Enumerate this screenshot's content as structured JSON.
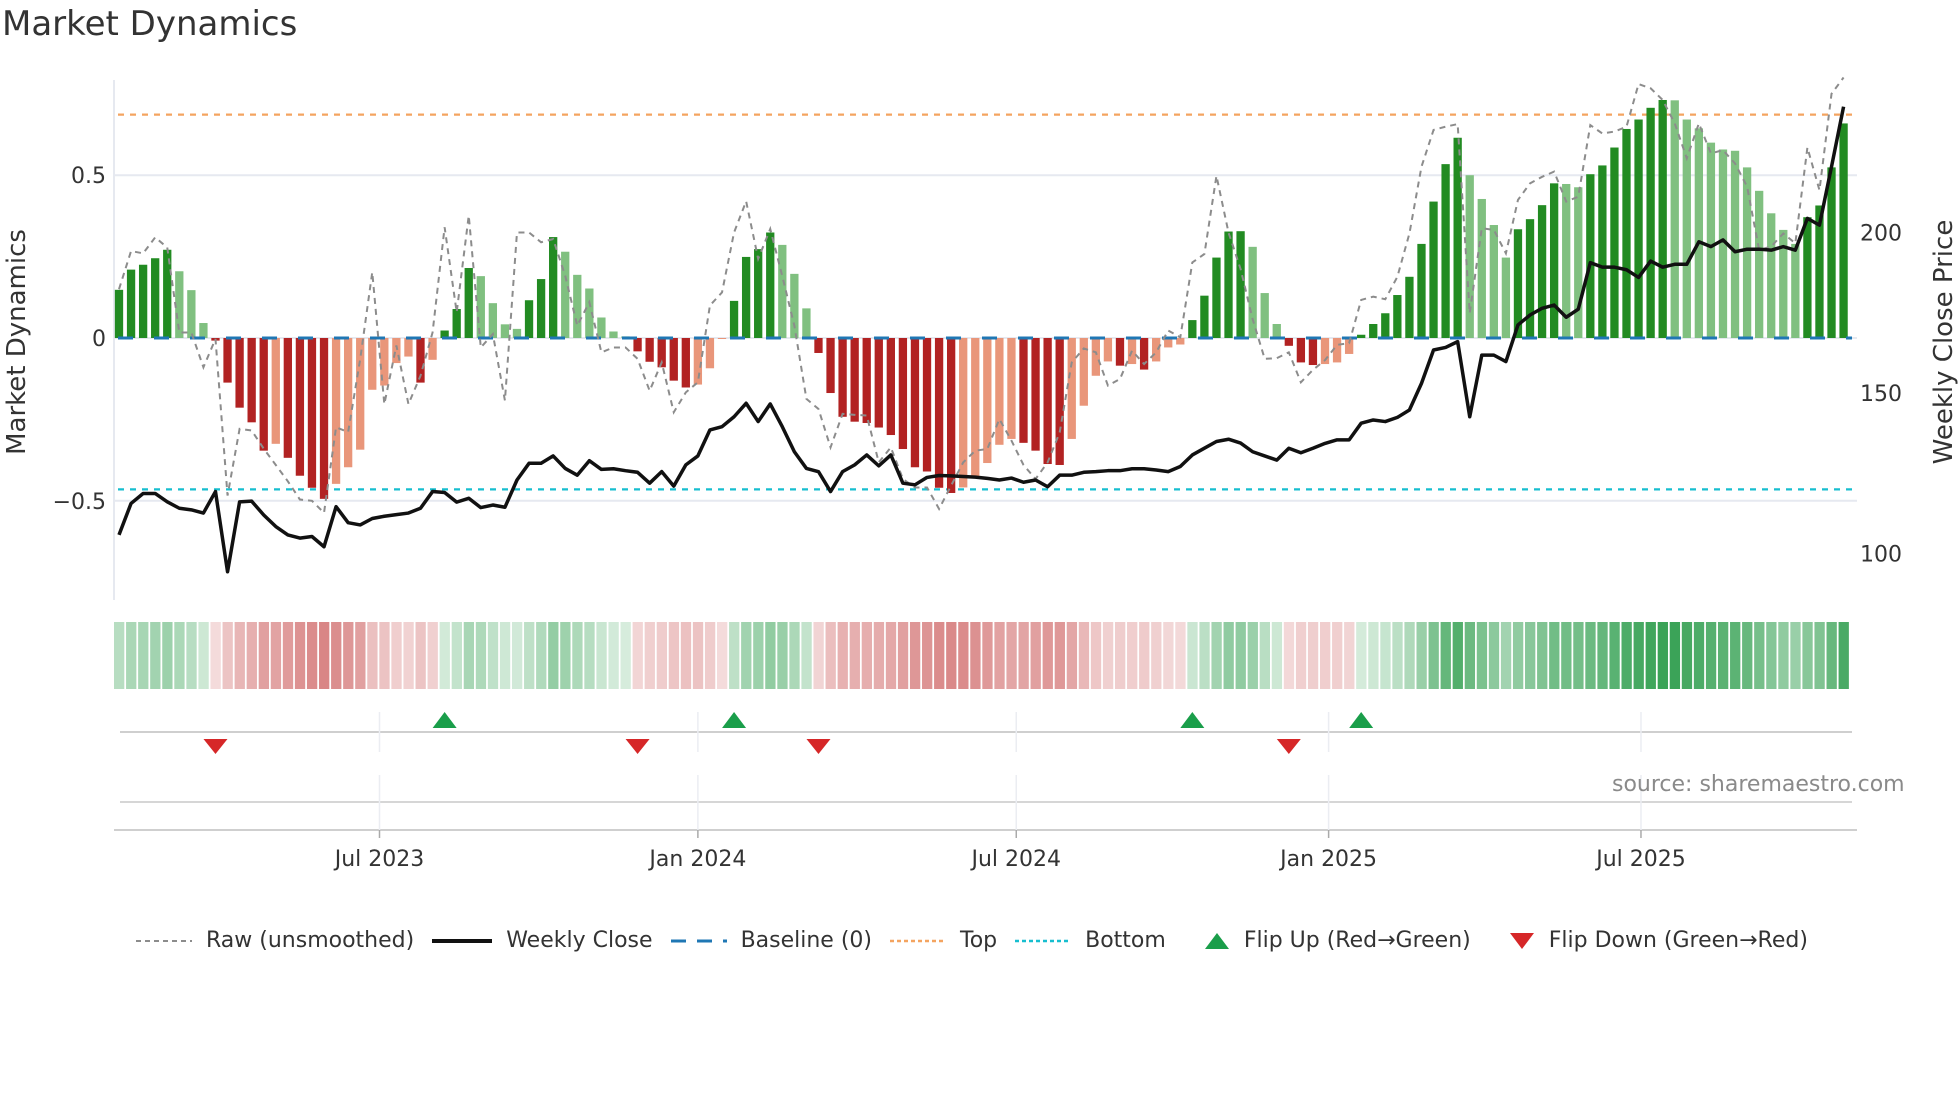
{
  "title": "Market Dynamics",
  "source": "source: sharemaestro.com",
  "legend": {
    "raw": "Raw (unsmoothed)",
    "close": "Weekly Close",
    "baseline": "Baseline (0)",
    "top": "Top",
    "bottom": "Bottom",
    "flip_up": "Flip Up (Red→Green)",
    "flip_down": "Flip Down (Green→Red)"
  },
  "colors": {
    "pos_strong": "#228b22",
    "pos_weak": "#80c080",
    "neg_strong": "#b22222",
    "neg_weak": "#e9967a",
    "raw": "#8c8c8c",
    "close": "#111111",
    "baseline": "#1f77b4",
    "top": "#f4a460",
    "bottom": "#17becf",
    "flip_up": "#1a9e4a",
    "flip_down": "#d62728"
  },
  "chart_data": {
    "type": "bar",
    "title": "Market Dynamics",
    "ylabel": "Market Dynamics",
    "y2label": "Weekly Close Price",
    "ylim": [
      -0.64,
      0.83
    ],
    "y2lim": [
      82,
      245
    ],
    "yticks": [
      {
        "v": 0.5,
        "label": "0.5"
      },
      {
        "v": 0,
        "label": "0"
      },
      {
        "v": -0.5,
        "label": "−0.5"
      }
    ],
    "y2ticks": [
      {
        "v": 200,
        "label": "200"
      },
      {
        "v": 150,
        "label": "150"
      },
      {
        "v": 100,
        "label": "100"
      }
    ],
    "xticks": [
      {
        "pos": 21.6,
        "label": "Jul 2023"
      },
      {
        "pos": 48.0,
        "label": "Jan 2024"
      },
      {
        "pos": 74.4,
        "label": "Jul 2024"
      },
      {
        "pos": 100.3,
        "label": "Jan 2025"
      },
      {
        "pos": 126.2,
        "label": "Jul 2025"
      }
    ],
    "top_level": 0.686,
    "bottom_level": -0.465,
    "baseline": 0,
    "legend_position": "bottom",
    "values": [
      0.148,
      0.21,
      0.225,
      0.245,
      0.271,
      0.205,
      0.147,
      0.046,
      -0.008,
      -0.137,
      -0.214,
      -0.259,
      -0.346,
      -0.325,
      -0.368,
      -0.423,
      -0.46,
      -0.494,
      -0.448,
      -0.397,
      -0.343,
      -0.159,
      -0.146,
      -0.077,
      -0.057,
      -0.137,
      -0.067,
      0.023,
      0.089,
      0.215,
      0.19,
      0.107,
      0.042,
      0.028,
      0.116,
      0.181,
      0.31,
      0.265,
      0.194,
      0.152,
      0.063,
      0.02,
      0.005,
      -0.041,
      -0.073,
      -0.09,
      -0.131,
      -0.152,
      -0.143,
      -0.093,
      -0.003,
      0.114,
      0.249,
      0.273,
      0.324,
      0.286,
      0.197,
      0.091,
      -0.046,
      -0.169,
      -0.242,
      -0.257,
      -0.261,
      -0.275,
      -0.298,
      -0.341,
      -0.397,
      -0.41,
      -0.46,
      -0.476,
      -0.459,
      -0.428,
      -0.384,
      -0.328,
      -0.31,
      -0.322,
      -0.346,
      -0.387,
      -0.39,
      -0.31,
      -0.208,
      -0.116,
      -0.072,
      -0.085,
      -0.08,
      -0.097,
      -0.072,
      -0.029,
      -0.02,
      0.055,
      0.13,
      0.247,
      0.327,
      0.328,
      0.28,
      0.138,
      0.043,
      -0.024,
      -0.075,
      -0.083,
      -0.08,
      -0.075,
      -0.049,
      0.01,
      0.043,
      0.076,
      0.132,
      0.188,
      0.289,
      0.419,
      0.534,
      0.615,
      0.5,
      0.427,
      0.347,
      0.247,
      0.334,
      0.365,
      0.408,
      0.475,
      0.473,
      0.463,
      0.503,
      0.53,
      0.585,
      0.642,
      0.671,
      0.707,
      0.731,
      0.73,
      0.671,
      0.644,
      0.6,
      0.579,
      0.575,
      0.524,
      0.452,
      0.383,
      0.332,
      0.289,
      0.371,
      0.407,
      0.524,
      0.659
    ],
    "raw": [
      0.15,
      0.267,
      0.26,
      0.309,
      0.278,
      0.017,
      0.017,
      -0.09,
      -0.003,
      -0.484,
      -0.279,
      -0.284,
      -0.34,
      -0.39,
      -0.44,
      -0.496,
      -0.5,
      -0.537,
      -0.274,
      -0.289,
      -0.065,
      0.202,
      -0.203,
      -0.023,
      -0.203,
      -0.116,
      0.017,
      0.34,
      0.079,
      0.376,
      -0.029,
      0.012,
      -0.192,
      0.324,
      0.324,
      0.294,
      0.304,
      0.191,
      0.038,
      0.11,
      -0.044,
      -0.029,
      -0.029,
      -0.064,
      -0.162,
      -0.075,
      -0.228,
      -0.167,
      -0.136,
      0.1,
      0.14,
      0.324,
      0.42,
      0.243,
      0.335,
      0.19,
      0.038,
      -0.187,
      -0.218,
      -0.336,
      -0.233,
      -0.236,
      -0.238,
      -0.382,
      -0.336,
      -0.433,
      -0.459,
      -0.459,
      -0.525,
      -0.453,
      -0.382,
      -0.346,
      -0.341,
      -0.249,
      -0.315,
      -0.39,
      -0.433,
      -0.382,
      -0.29,
      -0.075,
      -0.032,
      -0.044,
      -0.146,
      -0.126,
      -0.039,
      -0.08,
      -0.044,
      0.023,
      0.002,
      0.232,
      0.258,
      0.498,
      0.324,
      0.212,
      0.058,
      -0.064,
      -0.062,
      -0.044,
      -0.136,
      -0.098,
      -0.068,
      -0.021,
      -0.016,
      0.117,
      0.127,
      0.119,
      0.188,
      0.321,
      0.526,
      0.639,
      0.649,
      0.657,
      0.076,
      0.337,
      0.332,
      0.26,
      0.424,
      0.475,
      0.495,
      0.511,
      0.419,
      0.434,
      0.654,
      0.628,
      0.634,
      0.649,
      0.78,
      0.767,
      0.731,
      0.659,
      0.552,
      0.659,
      0.567,
      0.577,
      0.536,
      0.465,
      0.27,
      0.281,
      0.321,
      0.291,
      0.585,
      0.454,
      0.75,
      0.8
    ],
    "close": [
      105.8,
      115.6,
      118.7,
      118.7,
      116.1,
      114.1,
      113.6,
      112.6,
      119.3,
      94.3,
      116.1,
      116.3,
      112,
      108.4,
      105.8,
      104.8,
      105.3,
      102.1,
      114.6,
      109.6,
      108.9,
      110.9,
      111.6,
      112.1,
      112.6,
      114.1,
      119.3,
      119,
      116,
      117.2,
      114.3,
      115.1,
      114.4,
      122.9,
      128.1,
      128.1,
      130.4,
      126.5,
      124.4,
      128.9,
      126.2,
      126.4,
      125.8,
      125.3,
      121.9,
      125.5,
      121,
      127.6,
      130.4,
      138.5,
      139.5,
      142.6,
      146.8,
      141.1,
      146.6,
      139.5,
      131.7,
      126.5,
      125.5,
      119.3,
      125.5,
      127.6,
      130.7,
      127.3,
      130.7,
      121.9,
      121.4,
      123.7,
      124.3,
      124.2,
      124,
      123.8,
      123.4,
      122.9,
      123.5,
      122.2,
      122.9,
      120.8,
      124.4,
      124.4,
      125.3,
      125.5,
      125.8,
      125.8,
      126.4,
      126.4,
      126,
      125.5,
      127.1,
      130.7,
      132.8,
      134.9,
      135.6,
      134.4,
      131.7,
      130.4,
      129.1,
      132.8,
      131.4,
      132.8,
      134.3,
      135.4,
      135.4,
      140.6,
      141.6,
      141.1,
      142.4,
      144.7,
      153,
      163.4,
      164.2,
      166,
      142.6,
      161.8,
      161.8,
      159.8,
      171.2,
      174.3,
      176.4,
      177.4,
      173.6,
      176.1,
      190.6,
      189.2,
      189.2,
      188.4,
      186,
      191.1,
      189.2,
      190.1,
      190.1,
      197.1,
      195.6,
      197.7,
      194,
      194.8,
      194.8,
      194.5,
      195.6,
      194.5,
      204.4,
      202.3,
      220.5,
      239.2
    ],
    "flips_up": [
      27,
      51,
      89,
      103
    ],
    "flips_down": [
      8,
      43,
      58,
      97
    ]
  }
}
